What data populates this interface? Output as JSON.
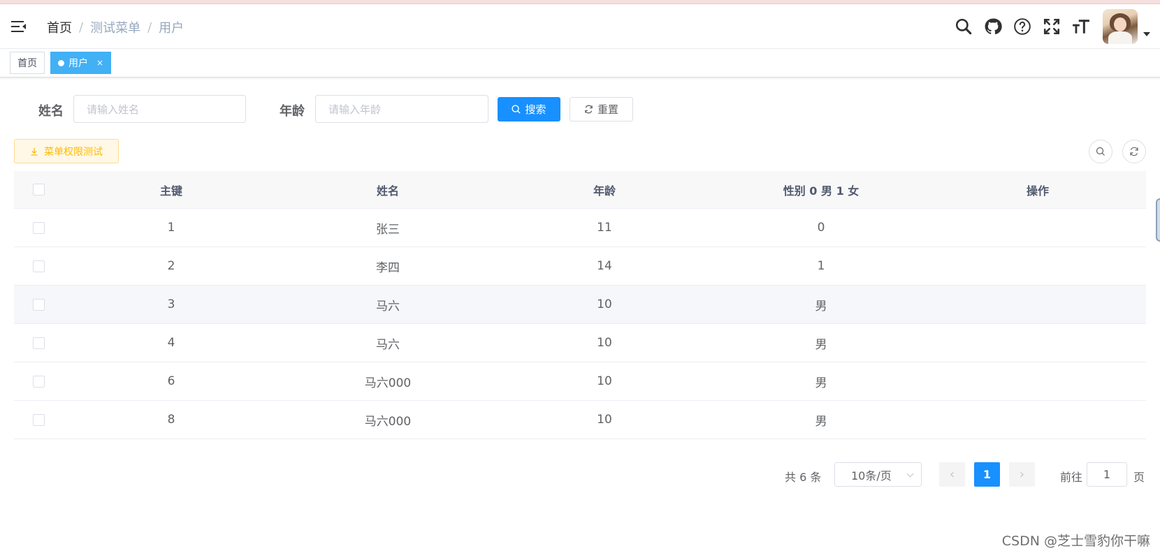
{
  "navbar": {
    "breadcrumb": [
      "首页",
      "测试菜单",
      "用户"
    ],
    "separator": "/"
  },
  "tags": {
    "home": "首页",
    "active": "用户",
    "close": "×"
  },
  "search": {
    "name_label": "姓名",
    "name_placeholder": "请输入姓名",
    "age_label": "年龄",
    "age_placeholder": "请输入年龄",
    "search_button": "搜索",
    "reset_button": "重置"
  },
  "toolbar": {
    "menu_permission_button": "菜单权限测试"
  },
  "table": {
    "columns": [
      "主键",
      "姓名",
      "年龄",
      "性别 0 男 1 女",
      "操作"
    ],
    "rows": [
      [
        "1",
        "张三",
        "11",
        "0",
        ""
      ],
      [
        "2",
        "李四",
        "14",
        "1",
        ""
      ],
      [
        "3",
        "马六",
        "10",
        "男",
        ""
      ],
      [
        "4",
        "马六",
        "10",
        "男",
        ""
      ],
      [
        "6",
        "马六000",
        "10",
        "男",
        ""
      ],
      [
        "8",
        "马六000",
        "10",
        "男",
        ""
      ]
    ]
  },
  "pagination": {
    "total": "共 6 条",
    "page_size": "10条/页",
    "current_page": "1",
    "goto_label": "前往",
    "goto_value": "1",
    "page_suffix": "页"
  },
  "watermark": "CSDN @芝士雪豹你干嘛",
  "colors": {
    "primary": "#1890ff",
    "tag_active": "#42b0f5",
    "warning": "#ffba00"
  }
}
